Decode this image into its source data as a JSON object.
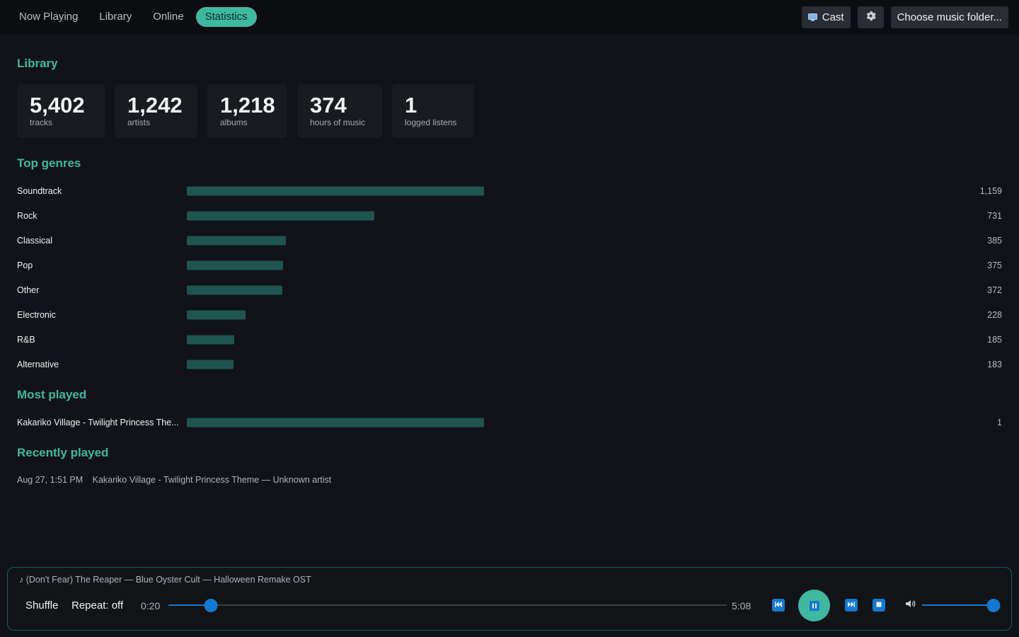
{
  "nav": {
    "tabs": [
      {
        "label": "Now Playing",
        "active": false
      },
      {
        "label": "Library",
        "active": false
      },
      {
        "label": "Online",
        "active": false
      },
      {
        "label": "Statistics",
        "active": true
      }
    ],
    "cast_label": "Cast",
    "cast_icon": "cast-icon",
    "settings_icon": "gear-icon",
    "choose_folder_label": "Choose music folder..."
  },
  "library": {
    "title": "Library",
    "stats": [
      {
        "value": "5,402",
        "label": "tracks"
      },
      {
        "value": "1,242",
        "label": "artists"
      },
      {
        "value": "1,218",
        "label": "albums"
      },
      {
        "value": "374",
        "label": "hours of music"
      },
      {
        "value": "1",
        "label": "logged listens"
      }
    ]
  },
  "top_genres": {
    "title": "Top genres",
    "items": [
      {
        "name": "Soundtrack",
        "count": "1,159",
        "value": 1159
      },
      {
        "name": "Rock",
        "count": "731",
        "value": 731
      },
      {
        "name": "Classical",
        "count": "385",
        "value": 385
      },
      {
        "name": "Pop",
        "count": "375",
        "value": 375
      },
      {
        "name": "Other",
        "count": "372",
        "value": 372
      },
      {
        "name": "Electronic",
        "count": "228",
        "value": 228
      },
      {
        "name": "R&B",
        "count": "185",
        "value": 185
      },
      {
        "name": "Alternative",
        "count": "183",
        "value": 183
      }
    ]
  },
  "most_played": {
    "title": "Most played",
    "items": [
      {
        "name": "Kakariko Village - Twilight Princess The...",
        "count": "1",
        "value": 1
      }
    ]
  },
  "recently_played": {
    "title": "Recently played",
    "items": [
      {
        "when": "Aug 27, 1:51 PM",
        "track": "Kakariko Village - Twilight Princess Theme — Unknown artist"
      }
    ]
  },
  "player": {
    "now_playing": "♪ (Don't Fear) The Reaper — Blue Oyster Cult — Halloween Remake OST",
    "shuffle_label": "Shuffle",
    "repeat_label": "Repeat: off",
    "elapsed": "0:20",
    "duration": "5:08",
    "progress_fraction": 0.076,
    "volume_fraction": 1.0,
    "icons": [
      "previous-icon",
      "pause-icon",
      "next-icon",
      "stop-icon",
      "volume-icon"
    ],
    "colors": {
      "accent": "#3fb8a0",
      "control_blue": "#1479d0"
    }
  }
}
